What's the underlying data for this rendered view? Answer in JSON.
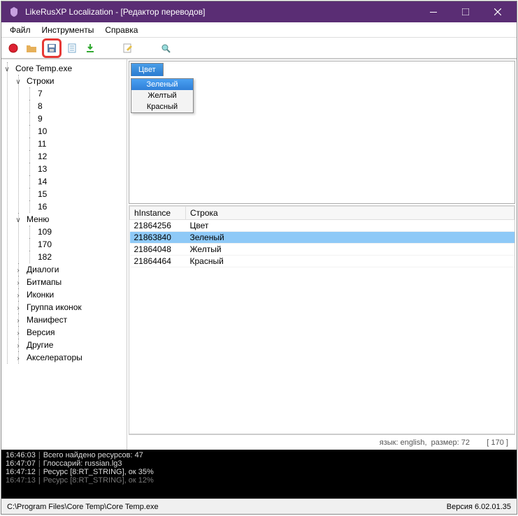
{
  "window": {
    "title": "LikeRusXP Localization - [Редактор переводов]"
  },
  "menu": {
    "file": "Файл",
    "tools": "Инструменты",
    "help": "Справка"
  },
  "tree": {
    "root": "Core Temp.exe",
    "strings": "Строки",
    "string_ids": [
      "7",
      "8",
      "9",
      "10",
      "11",
      "12",
      "13",
      "14",
      "15",
      "16"
    ],
    "menu": "Меню",
    "menu_ids": [
      "109",
      "170",
      "182"
    ],
    "dialogs": "Диалоги",
    "bitmaps": "Битмапы",
    "icons": "Иконки",
    "icon_group": "Группа иконок",
    "manifest": "Манифест",
    "version": "Версия",
    "other": "Другие",
    "accelerators": "Акселераторы"
  },
  "preview": {
    "tab": "Цвет",
    "items": {
      "green": "Зеленый",
      "yellow": "Желтый",
      "red": "Красный"
    }
  },
  "table": {
    "headers": {
      "hinstance": "hInstance",
      "string": "Строка"
    },
    "rows": [
      {
        "id": "21864256",
        "text": "Цвет"
      },
      {
        "id": "21863840",
        "text": "Зеленый"
      },
      {
        "id": "21864048",
        "text": "Желтый"
      },
      {
        "id": "21864464",
        "text": "Красный"
      }
    ]
  },
  "langbar": {
    "lang_label": "язык:",
    "lang_value": "english,",
    "size_label": "размер:",
    "size_value": "72",
    "count": "[ 170 ]"
  },
  "log": [
    {
      "time": "16:46:03",
      "msg": "Всего найдено ресурсов: 47"
    },
    {
      "time": "16:47:07",
      "msg": "Глоссарий: russian.lg3"
    },
    {
      "time": "16:47:12",
      "msg": "Ресурс [8:RT_STRING], ок 35%"
    },
    {
      "time": "16:47:13",
      "msg": "Ресурс [8:RT_STRING], ок 12%"
    }
  ],
  "statusbar": {
    "path": "C:\\Program Files\\Core Temp\\Core Temp.exe",
    "version": "Версия 6.02.01.35"
  }
}
